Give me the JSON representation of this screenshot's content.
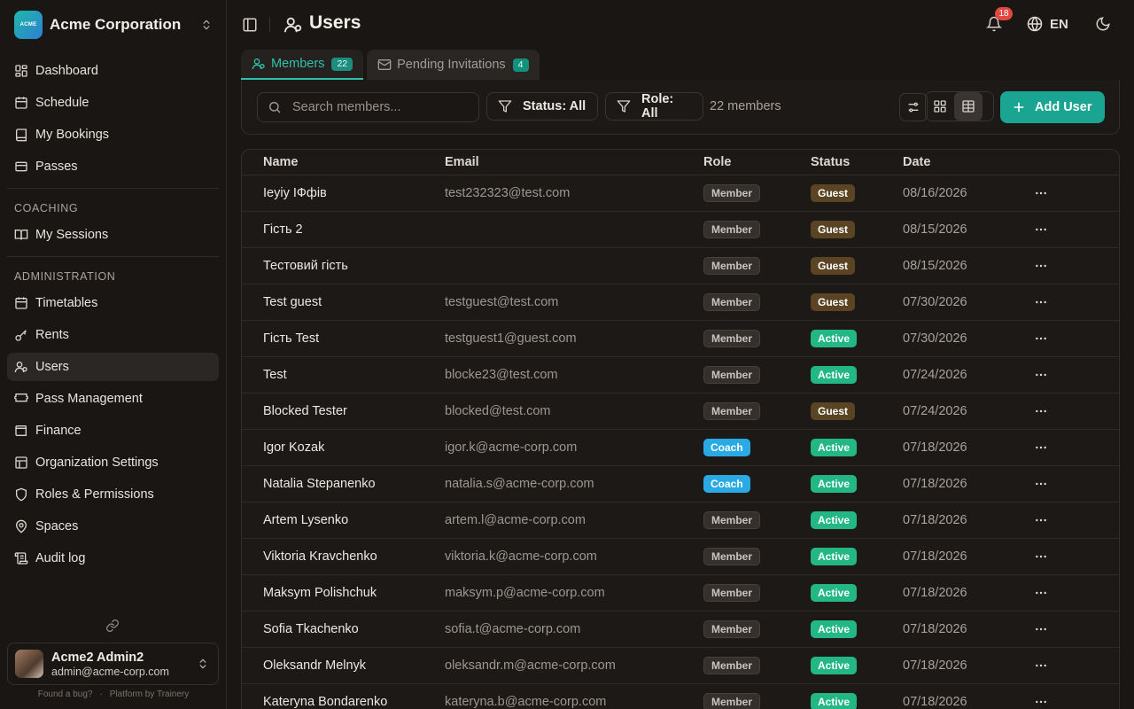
{
  "org": {
    "logo_text": "ACME",
    "name": "Acme Corporation"
  },
  "nav": {
    "main": [
      {
        "label": "Dashboard",
        "icon": "dashboard-icon"
      },
      {
        "label": "Schedule",
        "icon": "calendar-icon"
      },
      {
        "label": "My Bookings",
        "icon": "book-icon"
      },
      {
        "label": "Passes",
        "icon": "ticket-icon"
      }
    ],
    "coaching_label": "COACHING",
    "coaching": [
      {
        "label": "My Sessions",
        "icon": "book-open-icon"
      }
    ],
    "admin_label": "ADMINISTRATION",
    "admin": [
      {
        "label": "Timetables",
        "icon": "calendar-icon"
      },
      {
        "label": "Rents",
        "icon": "key-icon"
      },
      {
        "label": "Users",
        "icon": "users-icon",
        "active": true
      },
      {
        "label": "Pass Management",
        "icon": "ticket-icon"
      },
      {
        "label": "Finance",
        "icon": "wallet-icon"
      },
      {
        "label": "Organization Settings",
        "icon": "settings-icon"
      },
      {
        "label": "Roles & Permissions",
        "icon": "shield-icon"
      },
      {
        "label": "Spaces",
        "icon": "map-pin-icon"
      },
      {
        "label": "Audit log",
        "icon": "scroll-icon"
      }
    ]
  },
  "user": {
    "name": "Acme2 Admin2",
    "email": "admin@acme-corp.com"
  },
  "footer": {
    "bug": "Found a bug?",
    "dot": "·",
    "platform": "Platform by Trainery"
  },
  "header": {
    "title": "Users",
    "notifications": "18",
    "language": "EN"
  },
  "tabs": [
    {
      "label": "Members",
      "count": "22"
    },
    {
      "label": "Pending Invitations",
      "count": "4"
    }
  ],
  "toolbar": {
    "search_placeholder": "Search members...",
    "status_filter": "Status: All",
    "role_filter": "Role: All",
    "member_count": "22 members",
    "add_user": "Add User"
  },
  "table": {
    "headers": {
      "name": "Name",
      "email": "Email",
      "role": "Role",
      "status": "Status",
      "date": "Date"
    },
    "rows": [
      {
        "name": "Ieyiy IФфів",
        "email": "test232323@test.com",
        "role": "Member",
        "status": "Guest",
        "date": "08/16/2026"
      },
      {
        "name": "Гість 2",
        "email": "",
        "role": "Member",
        "status": "Guest",
        "date": "08/15/2026"
      },
      {
        "name": "Тестовий гість",
        "email": "",
        "role": "Member",
        "status": "Guest",
        "date": "08/15/2026"
      },
      {
        "name": "Test guest",
        "email": "testguest@test.com",
        "role": "Member",
        "status": "Guest",
        "date": "07/30/2026"
      },
      {
        "name": "Гість Test",
        "email": "testguest1@guest.com",
        "role": "Member",
        "status": "Active",
        "date": "07/30/2026"
      },
      {
        "name": "Test",
        "email": "blocke23@test.com",
        "role": "Member",
        "status": "Active",
        "date": "07/24/2026"
      },
      {
        "name": "Blocked Tester",
        "email": "blocked@test.com",
        "role": "Member",
        "status": "Guest",
        "date": "07/24/2026"
      },
      {
        "name": "Igor Kozak",
        "email": "igor.k@acme-corp.com",
        "role": "Coach",
        "status": "Active",
        "date": "07/18/2026"
      },
      {
        "name": "Natalia Stepanenko",
        "email": "natalia.s@acme-corp.com",
        "role": "Coach",
        "status": "Active",
        "date": "07/18/2026"
      },
      {
        "name": "Artem Lysenko",
        "email": "artem.l@acme-corp.com",
        "role": "Member",
        "status": "Active",
        "date": "07/18/2026"
      },
      {
        "name": "Viktoria Kravchenko",
        "email": "viktoria.k@acme-corp.com",
        "role": "Member",
        "status": "Active",
        "date": "07/18/2026"
      },
      {
        "name": "Maksym Polishchuk",
        "email": "maksym.p@acme-corp.com",
        "role": "Member",
        "status": "Active",
        "date": "07/18/2026"
      },
      {
        "name": "Sofia Tkachenko",
        "email": "sofia.t@acme-corp.com",
        "role": "Member",
        "status": "Active",
        "date": "07/18/2026"
      },
      {
        "name": "Oleksandr Melnyk",
        "email": "oleksandr.m@acme-corp.com",
        "role": "Member",
        "status": "Active",
        "date": "07/18/2026"
      },
      {
        "name": "Kateryna Bondarenko",
        "email": "kateryna.b@acme-corp.com",
        "role": "Member",
        "status": "Active",
        "date": "07/18/2026"
      }
    ]
  },
  "colors": {
    "accent": "#1aa592",
    "active": "#22b784",
    "guest": "#5b4424",
    "coach": "#2aaae5",
    "background": "#191614"
  }
}
